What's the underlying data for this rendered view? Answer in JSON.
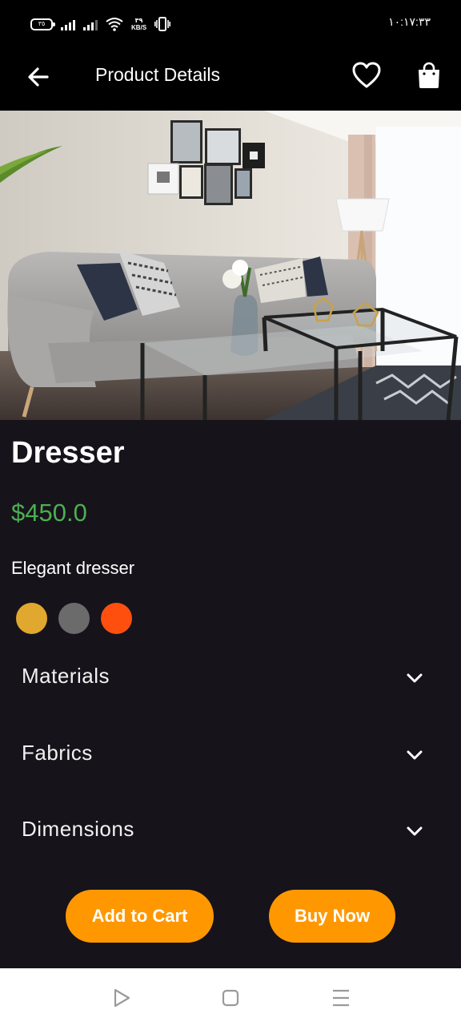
{
  "status_bar": {
    "battery_level": "٣٥",
    "speed_value": "٣٩",
    "speed_unit": "KB/S",
    "time": "١٠:١٧:٣٣"
  },
  "app_bar": {
    "title": "Product Details",
    "back_icon": "arrow-left-icon",
    "favorite_icon": "heart-outline-icon",
    "cart_icon": "shopping-bag-icon"
  },
  "product": {
    "name": "Dresser",
    "price": "$450.0",
    "description": "Elegant dresser",
    "colors": [
      "#e0a82e",
      "#6b6b6b",
      "#ff4f0f"
    ]
  },
  "sections": [
    {
      "label": "Materials"
    },
    {
      "label": "Fabrics"
    },
    {
      "label": "Dimensions"
    }
  ],
  "actions": {
    "add_to_cart": "Add to Cart",
    "buy_now": "Buy Now"
  },
  "theme": {
    "accent": "#ff9800",
    "price_color": "#4caf50",
    "background": "#16131b"
  },
  "system_nav": {
    "back_icon": "triangle-back-icon",
    "home_icon": "square-home-icon",
    "recents_icon": "menu-lines-icon"
  }
}
